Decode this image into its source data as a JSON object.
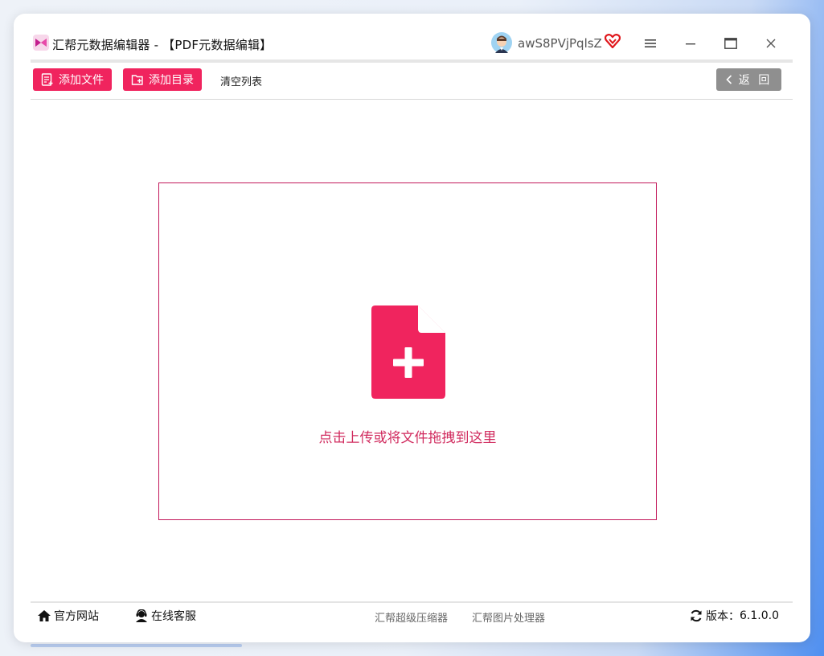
{
  "window": {
    "app_name": "汇帮元数据编辑器 - 【PDF元数据编辑】",
    "username": "awS8PVjPqlsZ"
  },
  "toolbar": {
    "add_file_label": "添加文件",
    "add_folder_label": "添加目录",
    "clear_list_label": "清空列表",
    "back_label": "返 回"
  },
  "dropzone": {
    "hint": "点击上传或将文件拖拽到这里"
  },
  "footer": {
    "website_label": "官方网站",
    "support_label": "在线客服",
    "compressor_label": "汇帮超级压缩器",
    "image_processor_label": "汇帮图片处理器",
    "version_label": "版本：",
    "version_value": "6.1.0.0"
  },
  "colors": {
    "accent": "#f0245e",
    "dropzone_border": "#c2185b",
    "back_button": "#8f8f8f"
  }
}
